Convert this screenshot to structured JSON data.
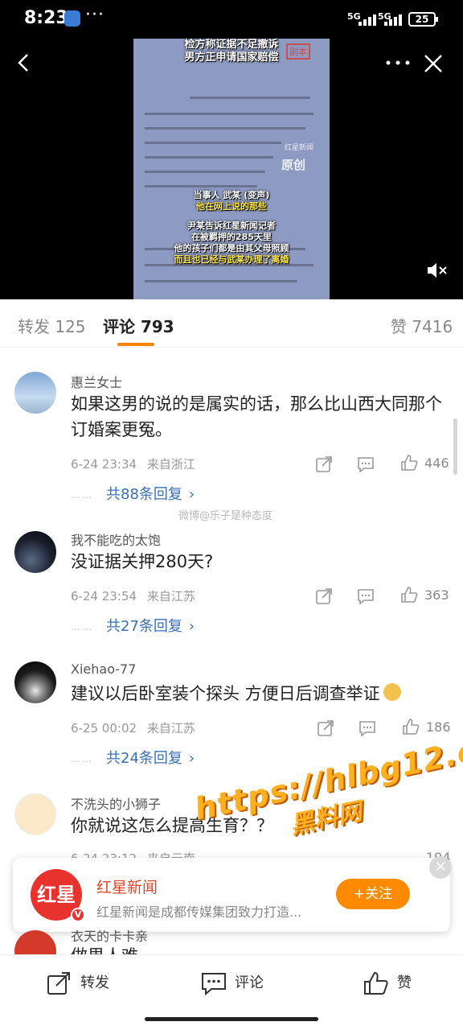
{
  "status_bar": {
    "time": "8:23",
    "more": "···",
    "net1": "5G",
    "net2": "5G",
    "battery": "25"
  },
  "video": {
    "caption_top": [
      "检方称证据不足撤诉",
      "男方正申请国家赔偿"
    ],
    "stamp": "副本",
    "watermark": "原创",
    "watermark_small": "红星新闻",
    "caption_mid": [
      "当事人 武某 (变声)",
      "他在网上说的那些"
    ],
    "caption_bottom": [
      "尹某告诉红星新闻记者",
      "在被羁押的285天里",
      "他的孩子们都是由其父母照顾",
      "而且也已经与武某办理了离婚"
    ]
  },
  "tabs": [
    {
      "label": "转发 125",
      "active": false
    },
    {
      "label": "评论 793",
      "active": true
    },
    {
      "label": "赞 7416",
      "active": false
    }
  ],
  "comments": [
    {
      "user": "惠兰女士",
      "text": "如果这男的说的是属实的话，那么比山西大同那个订婚案更冤。",
      "time": "6-24 23:34",
      "location": "来自浙江",
      "likes": "446",
      "replies": "共88条回复",
      "dots": "……"
    },
    {
      "user": "我不能吃的太饱",
      "text": "没证据关押280天?",
      "time": "6-24 23:54",
      "location": "来自江苏",
      "likes": "363",
      "replies": "共27条回复",
      "dots": "……"
    },
    {
      "user": "Xiehao-77",
      "text": "建议以后卧室装个探头 方便日后调查举证",
      "time": "6-25 00:02",
      "location": "来自江苏",
      "likes": "186",
      "replies": "共24条回复",
      "dots": "……"
    },
    {
      "user": "不洗头的小狮子",
      "text": "你就说这怎么提高生育？？",
      "time": "6-24 23:12",
      "location": "来自云南",
      "likes": "194"
    }
  ],
  "weibo_watermark": "微博@乐子是种态度",
  "site_watermark": {
    "url": "https://hlbg12.com",
    "name": "黑料网"
  },
  "follow_card": {
    "logo": "红星",
    "name": "红星新闻",
    "desc": "红星新闻是成都传媒集团致力打造...",
    "button": "+关注",
    "close": "×"
  },
  "partial_comment": {
    "user": "衣天的卡卡亲",
    "text": "做男人难"
  },
  "bottom_bar": {
    "repost": "转发",
    "comment": "评论",
    "like": "赞"
  },
  "colors": {
    "accent": "#ff8200",
    "link": "#3a6fb5",
    "follow": "#ff8a00",
    "brand_red": "#e8322d"
  }
}
